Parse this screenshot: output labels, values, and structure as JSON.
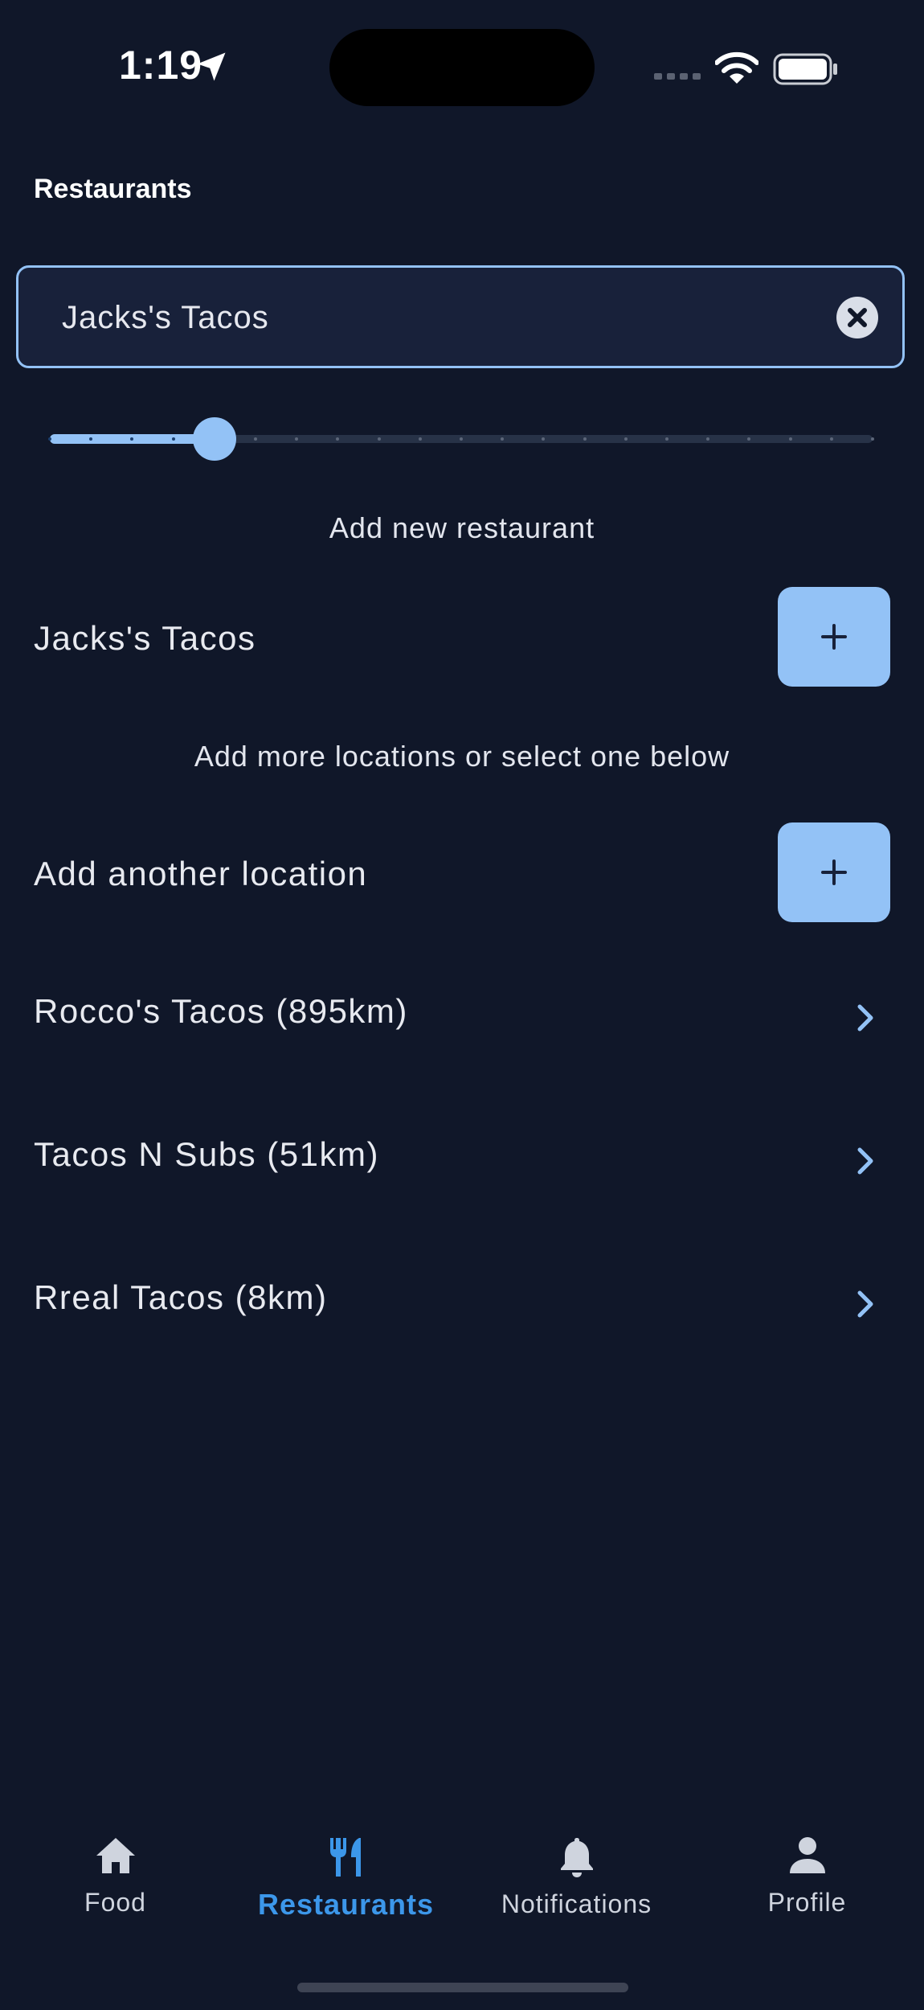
{
  "status_bar": {
    "time": "1:19",
    "icons": [
      "location-arrow-icon",
      "cellular-signal-icon",
      "wifi-icon",
      "battery-icon"
    ]
  },
  "header": {
    "title": "Restaurants"
  },
  "search": {
    "value": "Jacks's Tacos",
    "placeholder": ""
  },
  "slider": {
    "steps": 21,
    "selected_step": 4
  },
  "new_restaurant": {
    "section_label": "Add new restaurant",
    "name": "Jacks's Tacos"
  },
  "locations": {
    "section_label": "Add more locations or select one below",
    "add_label": "Add another location",
    "items": [
      {
        "label": "Rocco's Tacos (895km)"
      },
      {
        "label": "Tacos N Subs (51km)"
      },
      {
        "label": "Rreal Tacos (8km)"
      }
    ]
  },
  "bottom_nav": {
    "items": [
      {
        "label": "Food",
        "icon": "home-icon"
      },
      {
        "label": "Restaurants",
        "icon": "fork-knife-icon",
        "active": true
      },
      {
        "label": "Notifications",
        "icon": "bell-icon"
      },
      {
        "label": "Profile",
        "icon": "person-icon"
      }
    ]
  },
  "colors": {
    "background": "#101729",
    "accent": "#93c2f6",
    "active_nav": "#3c97ea"
  }
}
